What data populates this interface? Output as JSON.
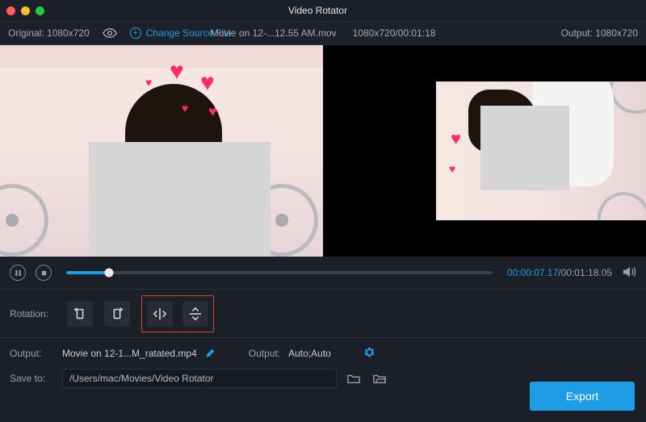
{
  "titlebar": {
    "title": "Video Rotator"
  },
  "infobar": {
    "original_label": "Original: 1080x720",
    "change_source_label": "Change Source File",
    "filename": "Movie on 12-...12.55 AM.mov",
    "meta": "1080x720/00:01:18",
    "output_label": "Output: 1080x720"
  },
  "playbar": {
    "current": "00:00:07.17",
    "total": "/00:01:18.05"
  },
  "rotation": {
    "label": "Rotation:"
  },
  "bottom": {
    "output_label": "Output:",
    "output_file": "Movie on 12-1...M_ratated.mp4",
    "output2_label": "Output:",
    "output2_value": "Auto;Auto",
    "save_label": "Save to:",
    "save_path": "/Users/mac/Movies/Video Rotator",
    "export_label": "Export"
  }
}
